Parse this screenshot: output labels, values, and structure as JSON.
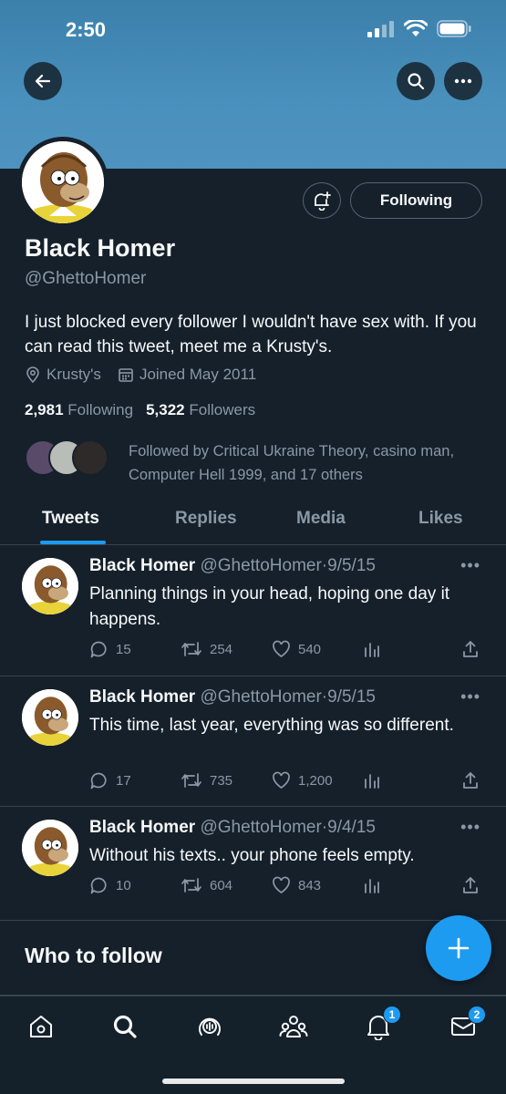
{
  "status_bar": {
    "time": "2:50"
  },
  "profile": {
    "name": "Black Homer",
    "handle": "@GhettoHomer",
    "bio": "I just blocked every follower I wouldn't have sex with. If you can read this tweet, meet me a Krusty's.",
    "location": "Krusty's",
    "joined": "Joined May 2011",
    "following_count": "2,981",
    "following_label": "Following",
    "followers_count": "5,322",
    "followers_label": "Followers",
    "followed_by": "Followed by Critical Ukraine Theory, casino man, Computer Hell 1999, and 17 others",
    "follow_button": "Following"
  },
  "tabs": [
    {
      "label": "Tweets",
      "active": true
    },
    {
      "label": "Replies",
      "active": false
    },
    {
      "label": "Media",
      "active": false
    },
    {
      "label": "Likes",
      "active": false
    }
  ],
  "tweets": [
    {
      "name": "Black Homer",
      "handle": "@GhettoHomer",
      "sep": "·",
      "date": "9/5/15",
      "text": "Planning things in your head, hoping one day it happens.",
      "replies": "15",
      "retweets": "254",
      "likes": "540"
    },
    {
      "name": "Black Homer",
      "handle": "@GhettoHomer",
      "sep": "·",
      "date": "9/5/15",
      "text": "This time, last year, everything was so different.",
      "replies": "17",
      "retweets": "735",
      "likes": "1,200"
    },
    {
      "name": "Black Homer",
      "handle": "@GhettoHomer",
      "sep": "·",
      "date": "9/4/15",
      "text": "Without his texts.. your phone feels empty.",
      "replies": "10",
      "retweets": "604",
      "likes": "843"
    }
  ],
  "who_to_follow": {
    "title": "Who to follow"
  },
  "tab_bar": {
    "items": [
      "home-icon",
      "search-icon",
      "spaces-icon",
      "communities-icon",
      "notifications-icon",
      "messages-icon"
    ],
    "notifications_badge": "1",
    "messages_badge": "2"
  },
  "colors": {
    "accent": "#1d9bf0",
    "background": "#15202b",
    "muted": "#8b98a5",
    "banner": "#4a90bd"
  }
}
